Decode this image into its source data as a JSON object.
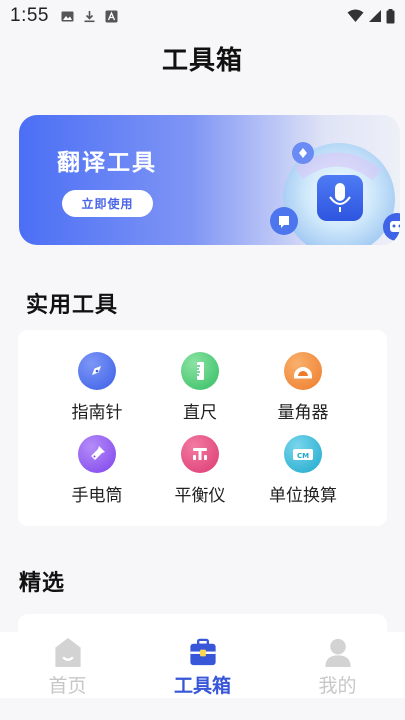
{
  "status_bar": {
    "time": "1:55",
    "icons": [
      "image-icon",
      "download-icon",
      "font-icon",
      "wifi-icon",
      "cellular-icon",
      "battery-icon"
    ]
  },
  "page": {
    "title": "工具箱"
  },
  "banner": {
    "title": "翻译工具",
    "button_label": "立即使用",
    "colors": {
      "start": "#4b6ff5",
      "end": "#eef0f7"
    }
  },
  "tools_section": {
    "title": "实用工具",
    "items": [
      {
        "label": "指南针",
        "icon": "compass-icon",
        "color": "#4a6cf0"
      },
      {
        "label": "直尺",
        "icon": "ruler-icon",
        "color": "#3ec46c"
      },
      {
        "label": "量角器",
        "icon": "protractor-icon",
        "color": "#f28a3a"
      },
      {
        "label": "手电筒",
        "icon": "flashlight-icon",
        "color": "#8a4ef0"
      },
      {
        "label": "平衡仪",
        "icon": "level-icon",
        "color": "#e3457c"
      },
      {
        "label": "单位换算",
        "icon": "unit-convert-icon",
        "color": "#2ab5d6"
      }
    ]
  },
  "featured_section": {
    "title": "精选"
  },
  "bottom_nav": {
    "items": [
      {
        "label": "首页",
        "icon": "home-icon",
        "active": false
      },
      {
        "label": "工具箱",
        "icon": "toolbox-icon",
        "active": true
      },
      {
        "label": "我的",
        "icon": "profile-icon",
        "active": false
      }
    ],
    "active_color": "#3756d8",
    "inactive_color": "#c7c7c7"
  }
}
